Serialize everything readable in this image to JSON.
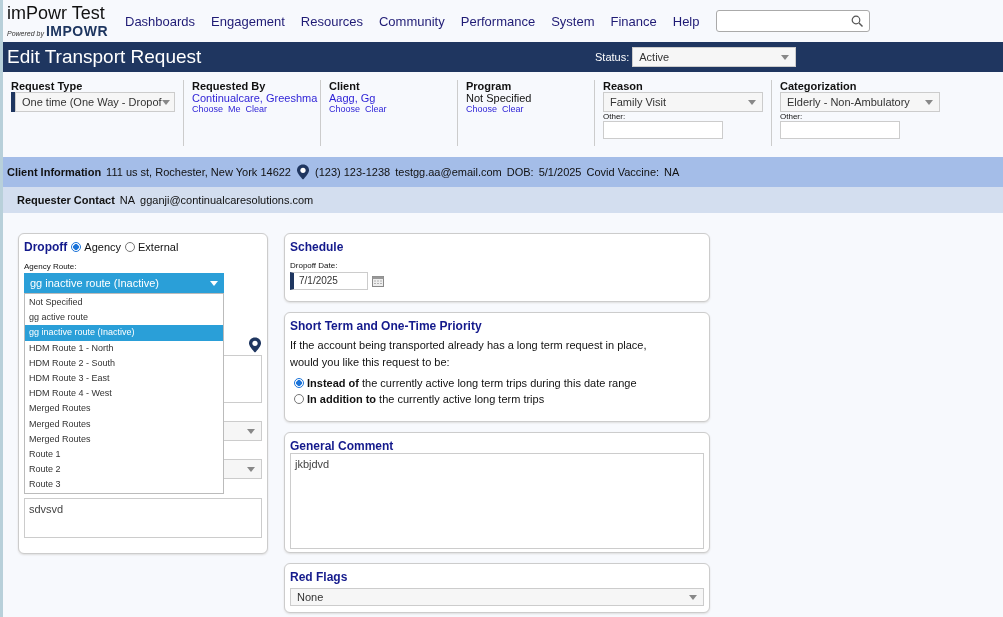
{
  "app": {
    "title": "imPowr Test",
    "powered_by": "Powered by",
    "brand": "IMPOWR"
  },
  "nav": [
    "Dashboards",
    "Engagement",
    "Resources",
    "Community",
    "Performance",
    "System",
    "Finance",
    "Help"
  ],
  "page": {
    "title": "Edit Transport Request",
    "status_label": "Status:",
    "status_value": "Active"
  },
  "fields": [
    {
      "kind": "select",
      "label": "Request Type",
      "value": "One time (One Way - Dropof",
      "required": true
    },
    {
      "kind": "links",
      "label": "Requested By",
      "value": "Continualcare, Greeshma",
      "links": [
        "Choose",
        "Me",
        "Clear"
      ]
    },
    {
      "kind": "links",
      "label": "Client",
      "value": "Aagg, Gg",
      "links": [
        "Choose",
        "Clear"
      ]
    },
    {
      "kind": "text",
      "label": "Program",
      "value": "Not Specified",
      "links": [
        "Choose",
        "Clear"
      ]
    },
    {
      "kind": "select_other",
      "label": "Reason",
      "value": "Family Visit",
      "other_label": "Other:"
    },
    {
      "kind": "select_other",
      "label": "Categorization",
      "value": "Elderly - Non-Ambulatory",
      "other_label": "Other:"
    }
  ],
  "client_info": {
    "label": "Client Information",
    "address": "111 us st, Rochester, New York 14622",
    "phone": "(123) 123-1238",
    "email": "testgg.aa@email.com",
    "dob_label": "DOB:",
    "dob": "5/1/2025",
    "vaccine_label": "Covid Vaccine:",
    "vaccine": "NA"
  },
  "requester_contact": {
    "label": "Requester Contact",
    "phone": "NA",
    "email": "gganji@continualcaresolutions.com"
  },
  "dropoff": {
    "title": "Dropoff",
    "options": [
      {
        "label": "Agency",
        "selected": true
      },
      {
        "label": "External",
        "selected": false
      }
    ],
    "route_label": "Agency Route:",
    "route_value": "gg inactive route (Inactive)",
    "expanded": true,
    "route_options": [
      {
        "label": "Not Specified",
        "selected": false
      },
      {
        "label": "gg active route",
        "selected": false
      },
      {
        "label": "gg inactive route (Inactive)",
        "selected": true
      },
      {
        "label": "HDM Route 1 - North",
        "selected": false
      },
      {
        "label": "HDM Route 2 - South",
        "selected": false
      },
      {
        "label": "HDM Route 3 - East",
        "selected": false
      },
      {
        "label": "HDM Route 4 - West",
        "selected": false
      },
      {
        "label": "Merged Routes",
        "selected": false
      },
      {
        "label": "Merged Routes",
        "selected": false
      },
      {
        "label": "Merged Routes",
        "selected": false
      },
      {
        "label": "Route 1",
        "selected": false
      },
      {
        "label": "Route 2",
        "selected": false
      },
      {
        "label": "Route 3",
        "selected": false
      }
    ],
    "comment": "sdvsvd"
  },
  "schedule": {
    "title": "Schedule",
    "date_label": "Dropoff Date:",
    "date": "7/1/2025"
  },
  "priority": {
    "title": "Short Term and One-Time Priority",
    "text": "If the account being transported already has a long term request in place, would you like this request to be:",
    "options": [
      {
        "label": "**Instead of** the currently active long term trips during this date range",
        "selected": true
      },
      {
        "label": "**In addition to** the currently active long term trips",
        "selected": false
      }
    ]
  },
  "general_comment": {
    "title": "General Comment",
    "value": "jkbjdvd"
  },
  "red_flags": {
    "title": "Red Flags",
    "value": "None"
  }
}
